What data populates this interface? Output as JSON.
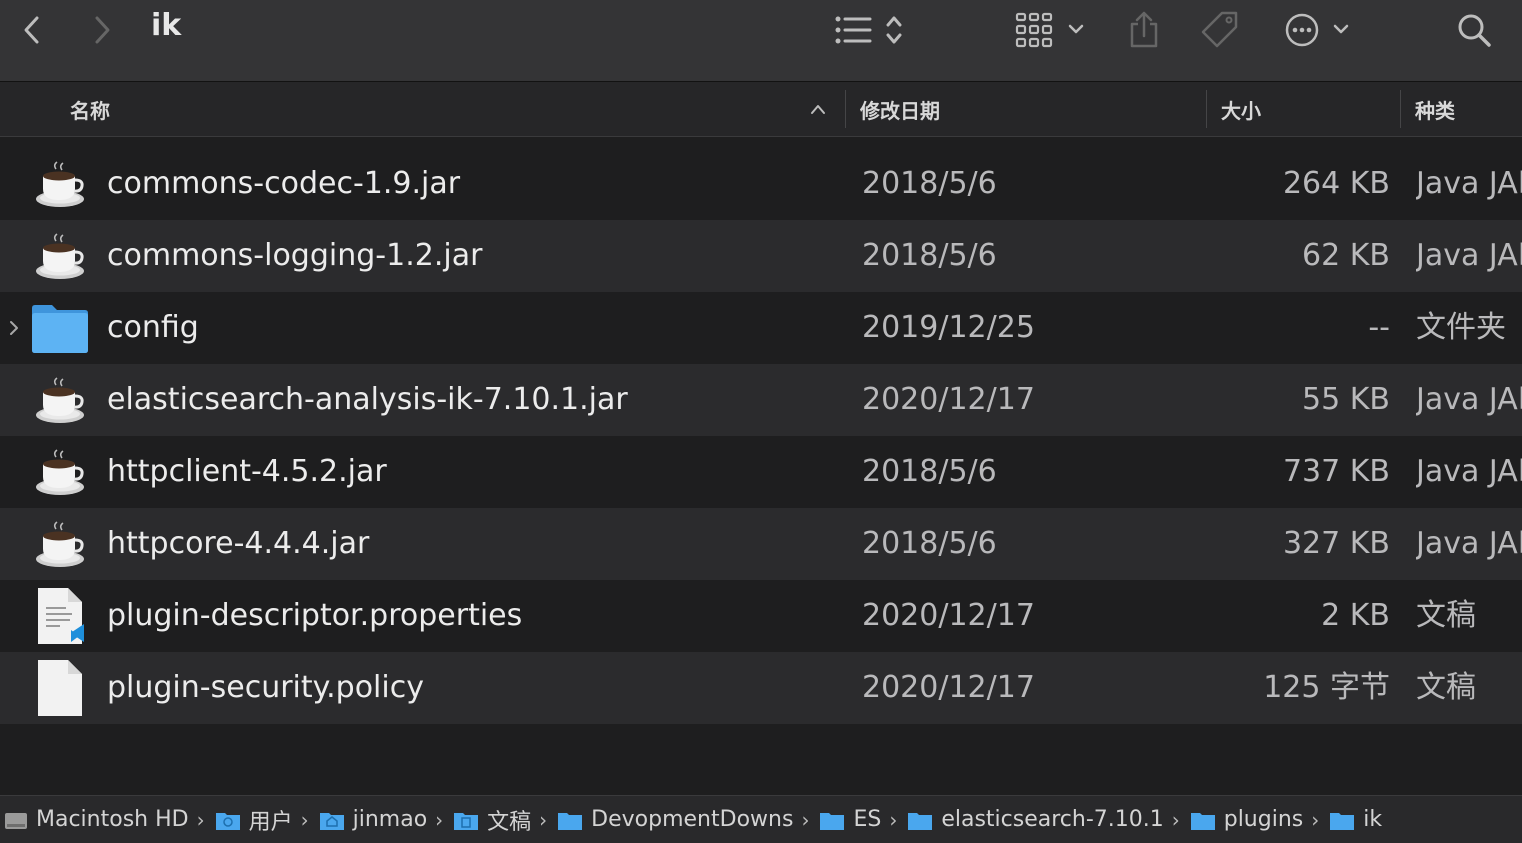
{
  "window": {
    "title": "ik"
  },
  "toolbar": {
    "back_icon": "chevron-left-icon",
    "forward_icon": "chevron-right-icon",
    "view_icon": "list-view-icon",
    "group_icon": "grid-group-icon",
    "share_icon": "share-icon",
    "tag_icon": "tag-icon",
    "action_icon": "more-actions-icon",
    "search_icon": "search-icon"
  },
  "columns": {
    "name": "名称",
    "date": "修改日期",
    "size": "大小",
    "kind": "种类"
  },
  "files": [
    {
      "name": "commons-codec-1.9.jar",
      "date": "2018/5/6",
      "size": "264 KB",
      "kind": "Java JAR",
      "icon": "java-jar-icon"
    },
    {
      "name": "commons-logging-1.2.jar",
      "date": "2018/5/6",
      "size": "62 KB",
      "kind": "Java JAR",
      "icon": "java-jar-icon"
    },
    {
      "name": "config",
      "date": "2019/12/25",
      "size": "--",
      "kind": "文件夹",
      "icon": "folder-icon"
    },
    {
      "name": "elasticsearch-analysis-ik-7.10.1.jar",
      "date": "2020/12/17",
      "size": "55 KB",
      "kind": "Java JAR",
      "icon": "java-jar-icon"
    },
    {
      "name": "httpclient-4.5.2.jar",
      "date": "2018/5/6",
      "size": "737 KB",
      "kind": "Java JAR",
      "icon": "java-jar-icon"
    },
    {
      "name": "httpcore-4.4.4.jar",
      "date": "2018/5/6",
      "size": "327 KB",
      "kind": "Java JAR",
      "icon": "java-jar-icon"
    },
    {
      "name": "plugin-descriptor.properties",
      "date": "2020/12/17",
      "size": "2 KB",
      "kind": "文稿",
      "icon": "properties-file-icon"
    },
    {
      "name": "plugin-security.policy",
      "date": "2020/12/17",
      "size": "125 字节",
      "kind": "文稿",
      "icon": "blank-document-icon"
    }
  ],
  "path": [
    {
      "label": "Macintosh HD",
      "icon": "hard-drive-icon"
    },
    {
      "label": "用户",
      "icon": "users-folder-icon"
    },
    {
      "label": "jinmao",
      "icon": "home-folder-icon"
    },
    {
      "label": "文稿",
      "icon": "documents-folder-icon"
    },
    {
      "label": "DevopmentDowns",
      "icon": "folder-icon"
    },
    {
      "label": "ES",
      "icon": "folder-icon"
    },
    {
      "label": "elasticsearch-7.10.1",
      "icon": "folder-icon"
    },
    {
      "label": "plugins",
      "icon": "folder-icon"
    },
    {
      "label": "ik",
      "icon": "folder-icon"
    }
  ],
  "colors": {
    "folder": "#4aa7ee",
    "row_alt": "#2b2b2d",
    "background": "#1e1e1f",
    "toolbar": "#343436"
  }
}
